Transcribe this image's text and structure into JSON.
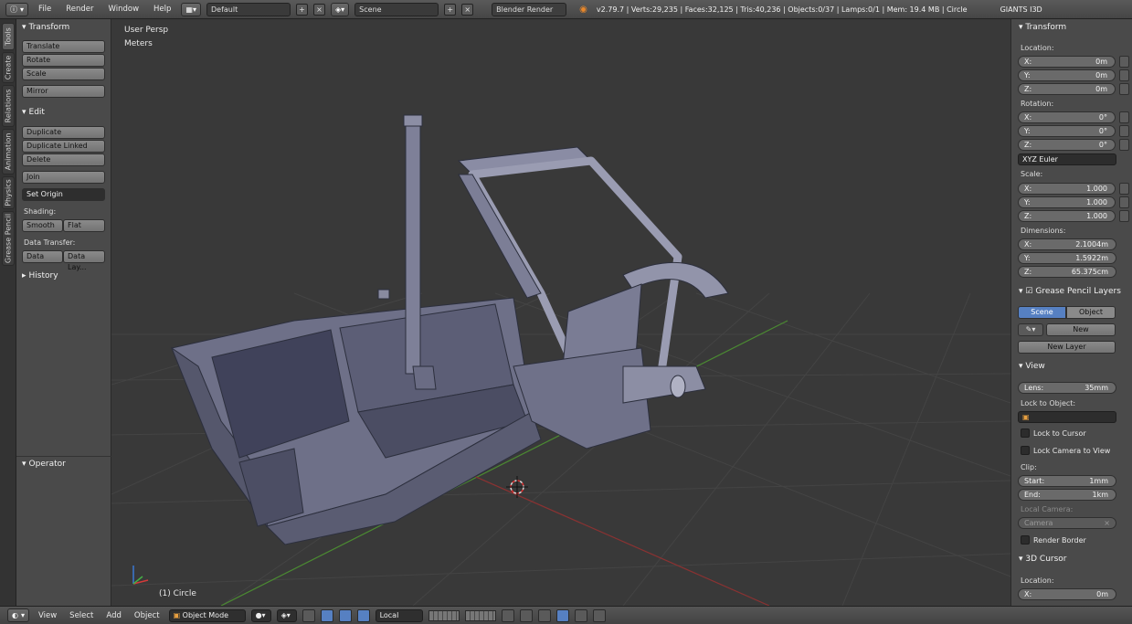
{
  "topbar": {
    "menus": [
      "File",
      "Render",
      "Window",
      "Help"
    ],
    "screen_layout": "Default",
    "scene": "Scene",
    "render_engine": "Blender Render",
    "stats": "v2.79.7 | Verts:29,235 | Faces:32,125 | Tris:40,236 | Objects:0/37 | Lamps:0/1 | Mem: 19.4 MB | Circle",
    "addon_label": "GIANTS I3D"
  },
  "left_tabs": [
    "Tools",
    "Create",
    "Relations",
    "Animation",
    "Physics",
    "Grease Pencil"
  ],
  "toolshelf": {
    "transform_header": "Transform",
    "translate": "Translate",
    "rotate": "Rotate",
    "scale": "Scale",
    "mirror": "Mirror",
    "edit_header": "Edit",
    "duplicate": "Duplicate",
    "duplicate_linked": "Duplicate Linked",
    "delete": "Delete",
    "join": "Join",
    "set_origin": "Set Origin",
    "shading_label": "Shading:",
    "smooth": "Smooth",
    "flat": "Flat",
    "data_transfer_label": "Data Transfer:",
    "data": "Data",
    "data_layout": "Data Lay...",
    "history_header": "History",
    "operator_header": "Operator"
  },
  "viewport": {
    "view_name": "User Persp",
    "units": "Meters",
    "object_label": "(1) Circle"
  },
  "properties": {
    "transform_header": "Transform",
    "location_label": "Location:",
    "location": {
      "x": "0m",
      "y": "0m",
      "z": "0m"
    },
    "rotation_label": "Rotation:",
    "rotation": {
      "x": "0°",
      "y": "0°",
      "z": "0°"
    },
    "rotation_mode": "XYZ Euler",
    "scale_label": "Scale:",
    "scale": {
      "x": "1.000",
      "y": "1.000",
      "z": "1.000"
    },
    "dimensions_label": "Dimensions:",
    "dimensions": {
      "x": "2.1004m",
      "y": "1.5922m",
      "z": "65.375cm"
    },
    "axis": {
      "x": "X:",
      "y": "Y:",
      "z": "Z:"
    },
    "grease_header": "Grease Pencil Layers",
    "scene_tab": "Scene",
    "object_tab": "Object",
    "new_btn": "New",
    "new_layer": "New Layer",
    "view_header": "View",
    "lens_label": "Lens:",
    "lens_value": "35mm",
    "lock_to_object": "Lock to Object:",
    "lock_to_cursor": "Lock to Cursor",
    "lock_camera_to_view": "Lock Camera to View",
    "clip_label": "Clip:",
    "clip_start_label": "Start:",
    "clip_start": "1mm",
    "clip_end_label": "End:",
    "clip_end": "1km",
    "local_camera_label": "Local Camera:",
    "camera_placeholder": "Camera",
    "render_border": "Render Border",
    "cursor_header": "3D Cursor",
    "cursor_location_label": "Location:",
    "cursor_x": "0m"
  },
  "bottombar": {
    "menus": [
      "View",
      "Select",
      "Add",
      "Object"
    ],
    "mode": "Object Mode",
    "orientation": "Local"
  }
}
